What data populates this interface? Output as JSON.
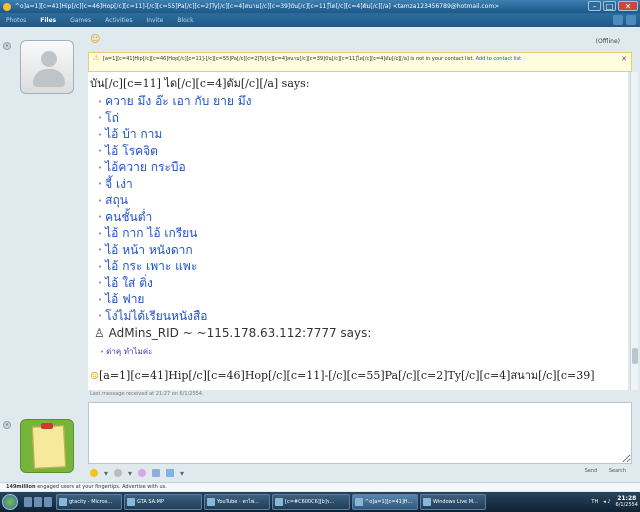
{
  "window": {
    "title": "^o]a=1][c=41]Hip[/c][c=46]Hop[/c][c=11]-[/c][c=55]Pa[/c][c=2]Ty[/c][c=4]สนาม[/c][c=39]บัน[/c][c=11]ได[/c][c=4]ดัม[/c][/a] <tamza123456789@hotmail.com>"
  },
  "menu": {
    "items": [
      "Photos",
      "Files",
      "Games",
      "Activities",
      "Invite",
      "Block"
    ],
    "active": "Files"
  },
  "header": {
    "status": "(Offline)"
  },
  "infobar": {
    "text": "[a=1][c=41]Hip[/c][c=46]Hop[/c][c=11]-[/c][c=55]Pa[/c][c=2]Ty[/c][c=4]สนาม[/c][c=39]บัน[/c][c=11]ได[/c][c=4]ดัม[/c][/a] is not in your contact list.",
    "link": "Add to contact list"
  },
  "conversation": {
    "sender1": "บัน[/c][c=11] ได[/c][c=4]ดัม[/c][/a] says:",
    "messages": [
      "ควาย มึง อ๊ะ เอา กับ ยาย มึง",
      "โถ่",
      "ไอ้ บ้า กาม",
      "ไอ้ โรคจิต",
      "ไอ้ควาย กระบือ",
      "จี้ เง่า",
      "สถุน",
      "คนชั้นต่ำ",
      "ไอ้ กาก ไอ้ เกรียน",
      "ไอ้ หน้า หนังดาก",
      "ไอ้ กระ เพาะ แพะ",
      "ไอ้ ใส่ ติ่ง",
      "ไอ้ ฟาย",
      "โง่ไม่ได้เรียนหนังสือ"
    ],
    "sender2": "AdMins_RID ~   ~115.178.63.112:7777 says:",
    "reply": "ด่าคุ ทำไมค่ะ",
    "contact_line": "[a=1][c=41]Hip[/c][c=46]Hop[/c][c=11]-[/c][c=55]Pa[/c][c=2]Ty[/c][c=4]สนาม[/c][c=39]"
  },
  "last_message": "Last message received at 21:27 on 6/1/2554.",
  "input": {
    "value": "",
    "right_labels": [
      "Send",
      "Search"
    ]
  },
  "ad": {
    "count": "149million",
    "text": " engaged users at your fingertips. Advertise with us."
  },
  "taskbar": {
    "tasks": [
      {
        "label": "gtacity - Micros..."
      },
      {
        "label": "GTA SA:MP"
      },
      {
        "label": "YouTube - พาไพ่..."
      },
      {
        "label": "[c=#C600C6][b]ร..."
      },
      {
        "label": "^o]a=1][c=41]H..."
      },
      {
        "label": "Windows Live M..."
      }
    ],
    "lang": "TH",
    "time": "21:28",
    "date": "6/1/2554"
  },
  "colors": {
    "accent": "#1f52c8",
    "titlebar": "#1c5787"
  }
}
